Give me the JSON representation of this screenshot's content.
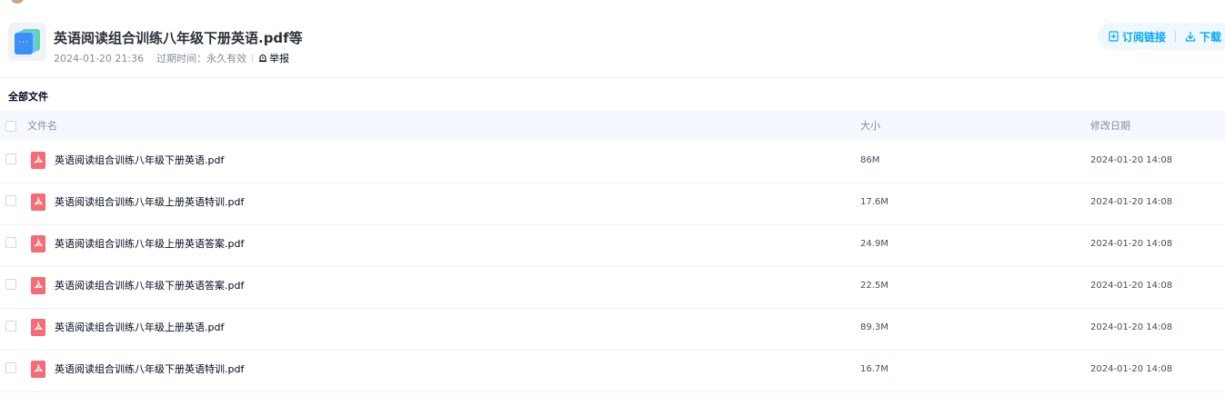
{
  "share": {
    "title": "英语阅读组合训练八年级下册英语.pdf等",
    "date": "2024-01-20 21:36",
    "expiry_label": "过期时间：",
    "expiry_value": "永久有效",
    "report": "举报"
  },
  "actions": {
    "subscribe": "订阅链接",
    "download": "下载"
  },
  "breadcrumb": "全部文件",
  "table": {
    "columns": {
      "name": "文件名",
      "size": "大小",
      "date": "修改日期"
    },
    "rows": [
      {
        "name": "英语阅读组合训练八年级下册英语.pdf",
        "size": "86M",
        "date": "2024-01-20 14:08"
      },
      {
        "name": "英语阅读组合训练八年级上册英语特训.pdf",
        "size": "17.6M",
        "date": "2024-01-20 14:08"
      },
      {
        "name": "英语阅读组合训练八年级上册英语答案.pdf",
        "size": "24.9M",
        "date": "2024-01-20 14:08"
      },
      {
        "name": "英语阅读组合训练八年级下册英语答案.pdf",
        "size": "22.5M",
        "date": "2024-01-20 14:08"
      },
      {
        "name": "英语阅读组合训练八年级上册英语.pdf",
        "size": "89.3M",
        "date": "2024-01-20 14:08"
      },
      {
        "name": "英语阅读组合训练八年级下册英语特训.pdf",
        "size": "16.7M",
        "date": "2024-01-20 14:08"
      }
    ]
  },
  "icons": {
    "share_folder": "multi-file-stack-icon",
    "report": "warning-bell-icon",
    "subscribe": "bookmark-plus-icon",
    "download": "download-icon",
    "file": "pdf-file-icon"
  },
  "colors": {
    "accent": "#06a7ff",
    "pdf_red": "#f56c75",
    "header_bg": "#f5f8fe",
    "muted_text": "#878c9c"
  }
}
